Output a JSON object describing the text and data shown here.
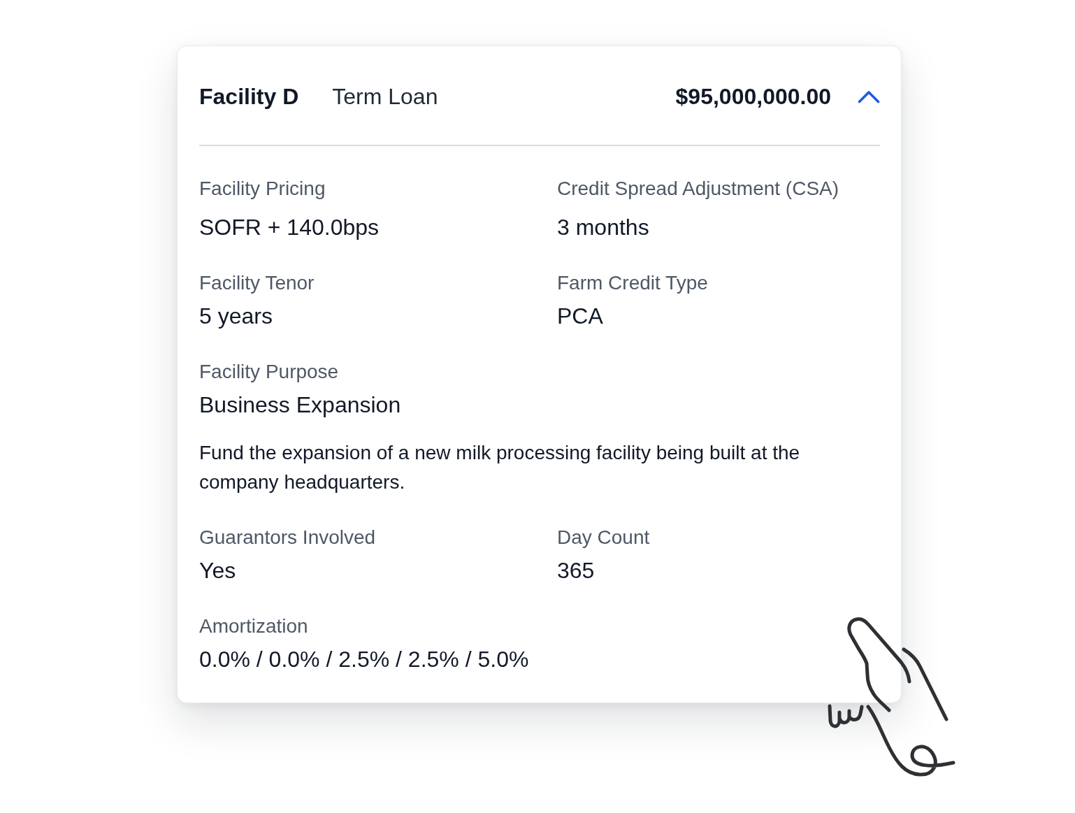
{
  "facility": {
    "name": "Facility D",
    "type": "Term Loan",
    "amount": "$95,000,000.00",
    "expanded": true
  },
  "sections": [
    {
      "kind": "fields",
      "fields": [
        {
          "label": "Facility Pricing",
          "value": "SOFR + 140.0bps"
        },
        {
          "label": "Credit Spread Adjustment (CSA)",
          "value": "3 months"
        }
      ]
    },
    {
      "kind": "fields",
      "fields": [
        {
          "label": "Facility Tenor",
          "value": "5 years"
        },
        {
          "label": "Farm Credit Type",
          "value": "PCA"
        }
      ]
    },
    {
      "kind": "fields",
      "fields": [
        {
          "label": "Facility Purpose",
          "value": "Business Expansion"
        }
      ]
    },
    {
      "kind": "note",
      "text": "Fund the expansion of a new milk processing facility being built at the company headquarters."
    },
    {
      "kind": "fields",
      "fields": [
        {
          "label": "Guarantors Involved",
          "value": "Yes"
        },
        {
          "label": "Day Count",
          "value": "365"
        }
      ]
    },
    {
      "kind": "fields",
      "fields": [
        {
          "label": "Amortization",
          "value": "0.0% / 0.0% / 2.5% / 2.5% / 5.0%"
        }
      ]
    }
  ]
}
